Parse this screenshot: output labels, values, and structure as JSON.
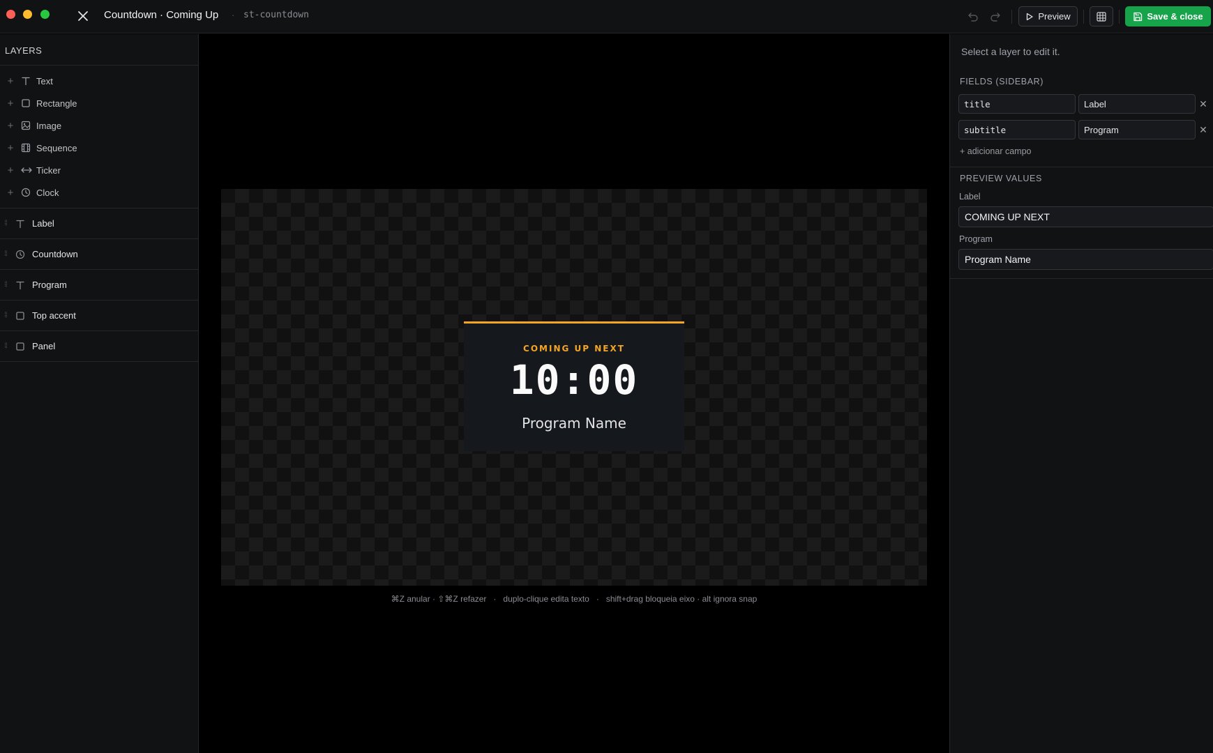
{
  "window": {
    "title": "Countdown · Coming Up",
    "separator": "·",
    "slug": "st-countdown"
  },
  "toolbar": {
    "preview_label": "Preview",
    "save_label": "Save & close"
  },
  "layers_panel": {
    "header": "LAYERS",
    "add_items": [
      {
        "label": "Text",
        "icon": "text-icon"
      },
      {
        "label": "Rectangle",
        "icon": "rectangle-icon"
      },
      {
        "label": "Image",
        "icon": "image-icon"
      },
      {
        "label": "Sequence",
        "icon": "sequence-icon"
      },
      {
        "label": "Ticker",
        "icon": "ticker-icon"
      },
      {
        "label": "Clock",
        "icon": "clock-icon"
      }
    ],
    "layers": [
      {
        "label": "Label",
        "icon": "text-icon"
      },
      {
        "label": "Countdown",
        "icon": "clock-icon"
      },
      {
        "label": "Program",
        "icon": "text-icon"
      },
      {
        "label": "Top accent",
        "icon": "rectangle-icon"
      },
      {
        "label": "Panel",
        "icon": "rectangle-icon"
      }
    ]
  },
  "canvas": {
    "label": "COMING UP NEXT",
    "time": "10:00",
    "program": "Program Name",
    "accent_color": "#f5a524",
    "hints": "⌘Z anular · ⇧⌘Z refazer   ·   duplo-clique edita texto   ·   shift+drag bloqueia eixo · alt ignora snap"
  },
  "inspector": {
    "hint": "Select a layer to edit it.",
    "fields_title": "FIELDS (SIDEBAR)",
    "fields": [
      {
        "key": "title",
        "label": "Label"
      },
      {
        "key": "subtitle",
        "label": "Program"
      }
    ],
    "add_field": "+ adicionar campo",
    "preview_title": "PREVIEW VALUES",
    "preview_values": [
      {
        "label": "Label",
        "value": "COMING UP NEXT"
      },
      {
        "label": "Program",
        "value": "Program Name"
      }
    ]
  },
  "colors": {
    "save_button": "#16a34a",
    "accent": "#f5a524"
  }
}
